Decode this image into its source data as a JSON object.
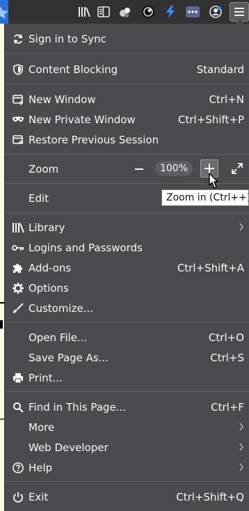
{
  "toolbar": {
    "icons": [
      "star-icon",
      "library-icon",
      "sidebar-icon",
      "extension-icon",
      "avatar-icon",
      "bolt-icon",
      "more-icon",
      "sync-account-icon",
      "hamburger-menu-icon"
    ]
  },
  "menu": {
    "sign_in": "Sign in to Sync",
    "content_blocking": "Content Blocking",
    "content_blocking_value": "Standard",
    "new_window": "New Window",
    "new_window_shortcut": "Ctrl+N",
    "new_private_window": "New Private Window",
    "new_private_window_shortcut": "Ctrl+Shift+P",
    "restore_session": "Restore Previous Session",
    "zoom": "Zoom",
    "zoom_value": "100%",
    "edit": "Edit",
    "library": "Library",
    "logins": "Logins and Passwords",
    "addons": "Add-ons",
    "addons_shortcut": "Ctrl+Shift+A",
    "options": "Options",
    "customize": "Customize...",
    "open_file": "Open File...",
    "open_file_shortcut": "Ctrl+O",
    "save_page": "Save Page As...",
    "save_page_shortcut": "Ctrl+S",
    "print": "Print...",
    "find": "Find in This Page...",
    "find_shortcut": "Ctrl+F",
    "more": "More",
    "web_developer": "Web Developer",
    "help": "Help",
    "exit": "Exit",
    "exit_shortcut": "Ctrl+Shift+Q"
  },
  "tooltip": {
    "text": "Zoom in (Ctrl++)"
  },
  "colors": {
    "menu_bg": "#4a4a4f",
    "toolbar_bg": "#323234",
    "text": "#f9f9fa"
  }
}
